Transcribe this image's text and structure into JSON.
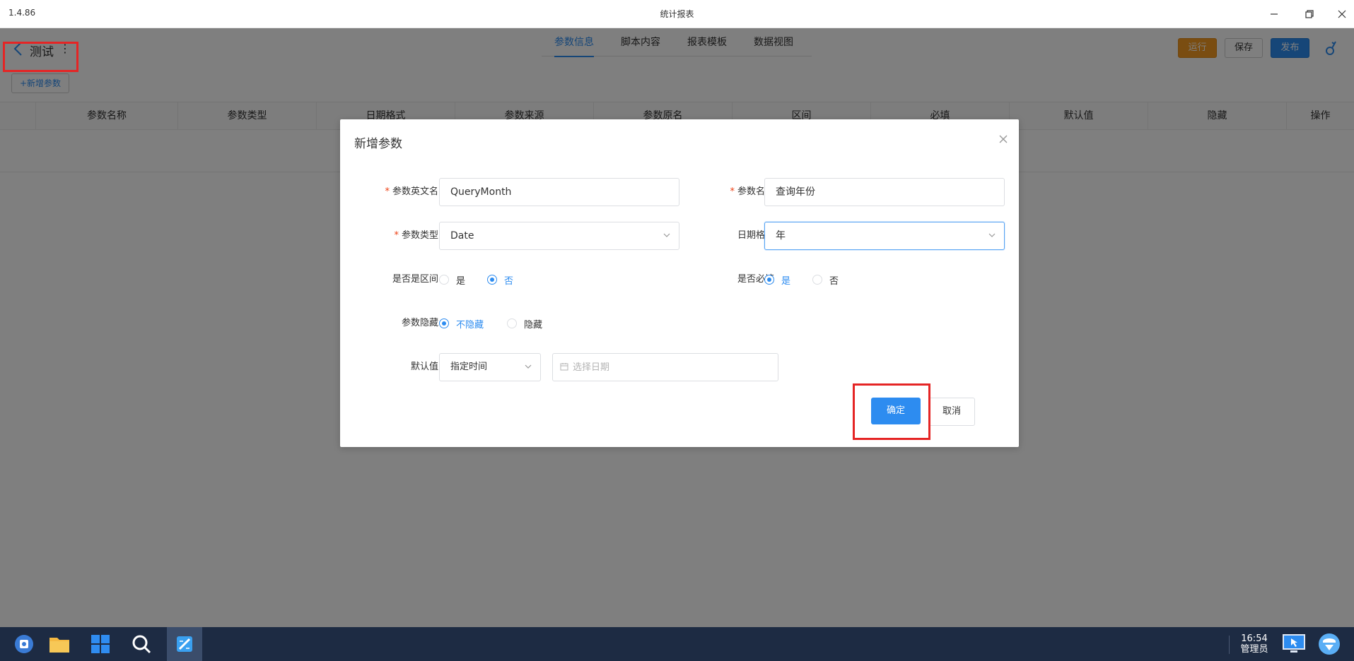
{
  "window": {
    "version": "1.4.86",
    "title": "统计报表"
  },
  "page": {
    "title": "测试",
    "tabs": [
      "参数信息",
      "脚本内容",
      "报表模板",
      "数据视图"
    ],
    "active_tab": "参数信息",
    "buttons": {
      "run": "运行",
      "save": "保存",
      "publish": "发布"
    },
    "add_param": "+新增参数",
    "table_headers": [
      "参数名称",
      "参数类型",
      "日期格式",
      "参数来源",
      "参数原名",
      "区间",
      "必填",
      "默认值",
      "隐藏",
      "操作"
    ]
  },
  "dialog": {
    "title": "新增参数",
    "fields": {
      "en_name": {
        "label": "参数英文名",
        "value": "QueryMonth",
        "required": true
      },
      "cn_name": {
        "label": "参数名称",
        "value": "查询年份",
        "required": true
      },
      "type": {
        "label": "参数类型",
        "value": "Date",
        "required": true
      },
      "date_format": {
        "label": "日期格式",
        "value": "年"
      },
      "is_range": {
        "label": "是否是区间",
        "yes": "是",
        "no": "否",
        "selected": "否"
      },
      "is_required": {
        "label": "是否必填",
        "yes": "是",
        "no": "否",
        "selected": "是"
      },
      "hidden": {
        "label": "参数隐藏",
        "opt1": "不隐藏",
        "opt2": "隐藏",
        "selected": "不隐藏"
      },
      "default": {
        "label": "默认值",
        "mode": "指定时间",
        "date_placeholder": "选择日期"
      }
    },
    "ok": "确定",
    "cancel": "取消"
  },
  "taskbar": {
    "time": "16:54",
    "user": "管理员"
  },
  "colors": {
    "primary": "#2d8cf0",
    "run": "#f59a23",
    "highlight": "#e52525",
    "taskbar": "#1d2b43"
  }
}
